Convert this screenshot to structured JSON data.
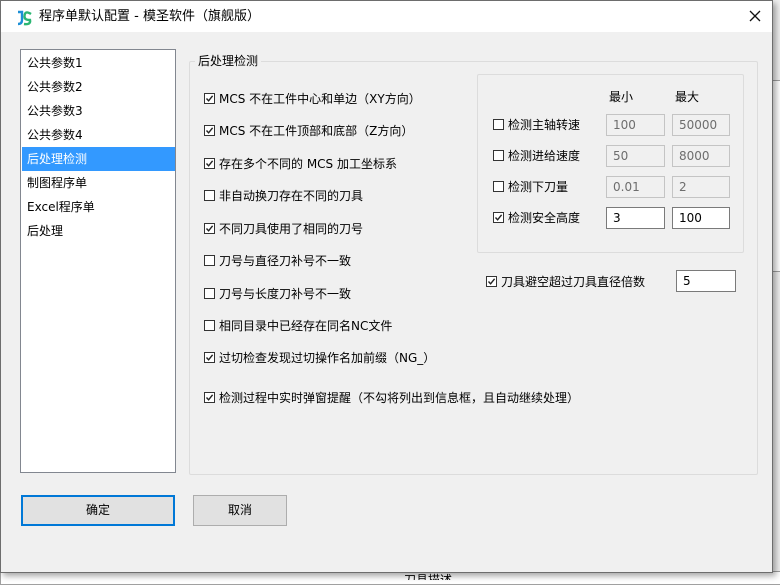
{
  "window": {
    "title": "程序单默认配置 - 模圣软件（旗舰版）"
  },
  "nav": {
    "items": [
      {
        "label": "公共参数1",
        "selected": false
      },
      {
        "label": "公共参数2",
        "selected": false
      },
      {
        "label": "公共参数3",
        "selected": false
      },
      {
        "label": "公共参数4",
        "selected": false
      },
      {
        "label": "后处理检测",
        "selected": true
      },
      {
        "label": "制图程序单",
        "selected": false
      },
      {
        "label": "Excel程序单",
        "selected": false
      },
      {
        "label": "后处理",
        "selected": false
      }
    ]
  },
  "group": {
    "title": "后处理检测",
    "checks": [
      {
        "label": "MCS 不在工件中心和单边（XY方向）",
        "checked": true
      },
      {
        "label": "MCS 不在工件顶部和底部（Z方向）",
        "checked": true
      },
      {
        "label": "存在多个不同的 MCS 加工坐标系",
        "checked": true
      },
      {
        "label": "非自动换刀存在不同的刀具",
        "checked": false
      },
      {
        "label": "不同刀具使用了相同的刀号",
        "checked": true
      },
      {
        "label": "刀号与直径刀补号不一致",
        "checked": false
      },
      {
        "label": "刀号与长度刀补号不一致",
        "checked": false
      },
      {
        "label": "相同目录中已经存在同名NC文件",
        "checked": false
      },
      {
        "label": "过切检查发现过切操作名加前缀（NG_）",
        "checked": true
      },
      {
        "label": "检测过程中实时弹窗提醒（不勾将列出到信息框，且自动继续处理）",
        "checked": true
      }
    ]
  },
  "limits": {
    "min_header": "最小",
    "max_header": "最大",
    "rows": [
      {
        "label": "检测主轴转速",
        "checked": false,
        "min": "100",
        "max": "50000"
      },
      {
        "label": "检测进给速度",
        "checked": false,
        "min": "50",
        "max": "8000"
      },
      {
        "label": "检测下刀量",
        "checked": false,
        "min": "0.01",
        "max": "2"
      },
      {
        "label": "检测安全高度",
        "checked": true,
        "min": "3",
        "max": "100"
      }
    ]
  },
  "clearance": {
    "label": "刀具避空超过刀具直径倍数",
    "checked": true,
    "value": "5"
  },
  "buttons": {
    "ok": "确定",
    "cancel": "取消"
  },
  "background": {
    "fragment": "刀具描述"
  },
  "colors": {
    "selection": "#3399ff",
    "default_button_border": "#0078d7"
  }
}
